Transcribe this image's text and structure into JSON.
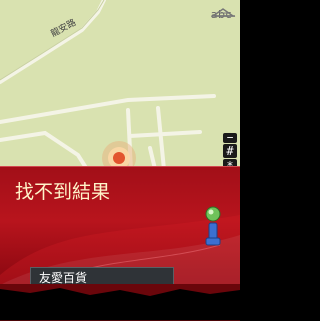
{
  "status": {
    "input_mode": "abc",
    "signal_icon": "signal-icon"
  },
  "map": {
    "road_label": "龍安路",
    "background_color": "#d9e2b0",
    "road_color": "#f4f4e6",
    "marker_color": "#e2542e"
  },
  "zoom_controls": {
    "zoom_out": "−",
    "hash": "#",
    "asterisk": "*",
    "zoom_in": "+"
  },
  "result_panel": {
    "title": "找不到結果",
    "info_icon": "info-icon",
    "selected_result": "友愛百貨"
  },
  "colors": {
    "panel_red": "#b8141d",
    "title_text": "#fff3c9",
    "bar_bg": "#2f3337"
  }
}
